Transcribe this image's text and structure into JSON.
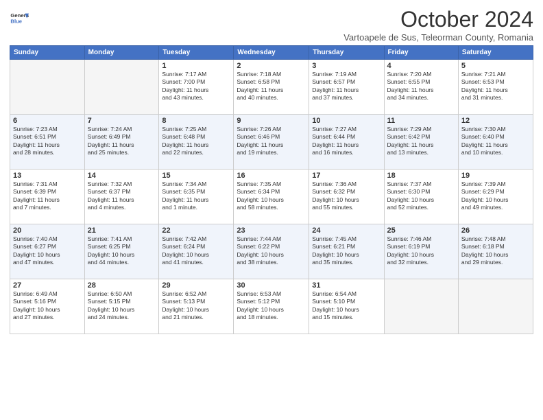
{
  "logo": {
    "line1": "General",
    "line2": "Blue"
  },
  "title": "October 2024",
  "subtitle": "Vartoapele de Sus, Teleorman County, Romania",
  "headers": [
    "Sunday",
    "Monday",
    "Tuesday",
    "Wednesday",
    "Thursday",
    "Friday",
    "Saturday"
  ],
  "weeks": [
    [
      {
        "day": "",
        "info": ""
      },
      {
        "day": "",
        "info": ""
      },
      {
        "day": "1",
        "info": "Sunrise: 7:17 AM\nSunset: 7:00 PM\nDaylight: 11 hours\nand 43 minutes."
      },
      {
        "day": "2",
        "info": "Sunrise: 7:18 AM\nSunset: 6:58 PM\nDaylight: 11 hours\nand 40 minutes."
      },
      {
        "day": "3",
        "info": "Sunrise: 7:19 AM\nSunset: 6:57 PM\nDaylight: 11 hours\nand 37 minutes."
      },
      {
        "day": "4",
        "info": "Sunrise: 7:20 AM\nSunset: 6:55 PM\nDaylight: 11 hours\nand 34 minutes."
      },
      {
        "day": "5",
        "info": "Sunrise: 7:21 AM\nSunset: 6:53 PM\nDaylight: 11 hours\nand 31 minutes."
      }
    ],
    [
      {
        "day": "6",
        "info": "Sunrise: 7:23 AM\nSunset: 6:51 PM\nDaylight: 11 hours\nand 28 minutes."
      },
      {
        "day": "7",
        "info": "Sunrise: 7:24 AM\nSunset: 6:49 PM\nDaylight: 11 hours\nand 25 minutes."
      },
      {
        "day": "8",
        "info": "Sunrise: 7:25 AM\nSunset: 6:48 PM\nDaylight: 11 hours\nand 22 minutes."
      },
      {
        "day": "9",
        "info": "Sunrise: 7:26 AM\nSunset: 6:46 PM\nDaylight: 11 hours\nand 19 minutes."
      },
      {
        "day": "10",
        "info": "Sunrise: 7:27 AM\nSunset: 6:44 PM\nDaylight: 11 hours\nand 16 minutes."
      },
      {
        "day": "11",
        "info": "Sunrise: 7:29 AM\nSunset: 6:42 PM\nDaylight: 11 hours\nand 13 minutes."
      },
      {
        "day": "12",
        "info": "Sunrise: 7:30 AM\nSunset: 6:40 PM\nDaylight: 11 hours\nand 10 minutes."
      }
    ],
    [
      {
        "day": "13",
        "info": "Sunrise: 7:31 AM\nSunset: 6:39 PM\nDaylight: 11 hours\nand 7 minutes."
      },
      {
        "day": "14",
        "info": "Sunrise: 7:32 AM\nSunset: 6:37 PM\nDaylight: 11 hours\nand 4 minutes."
      },
      {
        "day": "15",
        "info": "Sunrise: 7:34 AM\nSunset: 6:35 PM\nDaylight: 11 hours\nand 1 minute."
      },
      {
        "day": "16",
        "info": "Sunrise: 7:35 AM\nSunset: 6:34 PM\nDaylight: 10 hours\nand 58 minutes."
      },
      {
        "day": "17",
        "info": "Sunrise: 7:36 AM\nSunset: 6:32 PM\nDaylight: 10 hours\nand 55 minutes."
      },
      {
        "day": "18",
        "info": "Sunrise: 7:37 AM\nSunset: 6:30 PM\nDaylight: 10 hours\nand 52 minutes."
      },
      {
        "day": "19",
        "info": "Sunrise: 7:39 AM\nSunset: 6:29 PM\nDaylight: 10 hours\nand 49 minutes."
      }
    ],
    [
      {
        "day": "20",
        "info": "Sunrise: 7:40 AM\nSunset: 6:27 PM\nDaylight: 10 hours\nand 47 minutes."
      },
      {
        "day": "21",
        "info": "Sunrise: 7:41 AM\nSunset: 6:25 PM\nDaylight: 10 hours\nand 44 minutes."
      },
      {
        "day": "22",
        "info": "Sunrise: 7:42 AM\nSunset: 6:24 PM\nDaylight: 10 hours\nand 41 minutes."
      },
      {
        "day": "23",
        "info": "Sunrise: 7:44 AM\nSunset: 6:22 PM\nDaylight: 10 hours\nand 38 minutes."
      },
      {
        "day": "24",
        "info": "Sunrise: 7:45 AM\nSunset: 6:21 PM\nDaylight: 10 hours\nand 35 minutes."
      },
      {
        "day": "25",
        "info": "Sunrise: 7:46 AM\nSunset: 6:19 PM\nDaylight: 10 hours\nand 32 minutes."
      },
      {
        "day": "26",
        "info": "Sunrise: 7:48 AM\nSunset: 6:18 PM\nDaylight: 10 hours\nand 29 minutes."
      }
    ],
    [
      {
        "day": "27",
        "info": "Sunrise: 6:49 AM\nSunset: 5:16 PM\nDaylight: 10 hours\nand 27 minutes."
      },
      {
        "day": "28",
        "info": "Sunrise: 6:50 AM\nSunset: 5:15 PM\nDaylight: 10 hours\nand 24 minutes."
      },
      {
        "day": "29",
        "info": "Sunrise: 6:52 AM\nSunset: 5:13 PM\nDaylight: 10 hours\nand 21 minutes."
      },
      {
        "day": "30",
        "info": "Sunrise: 6:53 AM\nSunset: 5:12 PM\nDaylight: 10 hours\nand 18 minutes."
      },
      {
        "day": "31",
        "info": "Sunrise: 6:54 AM\nSunset: 5:10 PM\nDaylight: 10 hours\nand 15 minutes."
      },
      {
        "day": "",
        "info": ""
      },
      {
        "day": "",
        "info": ""
      }
    ]
  ]
}
